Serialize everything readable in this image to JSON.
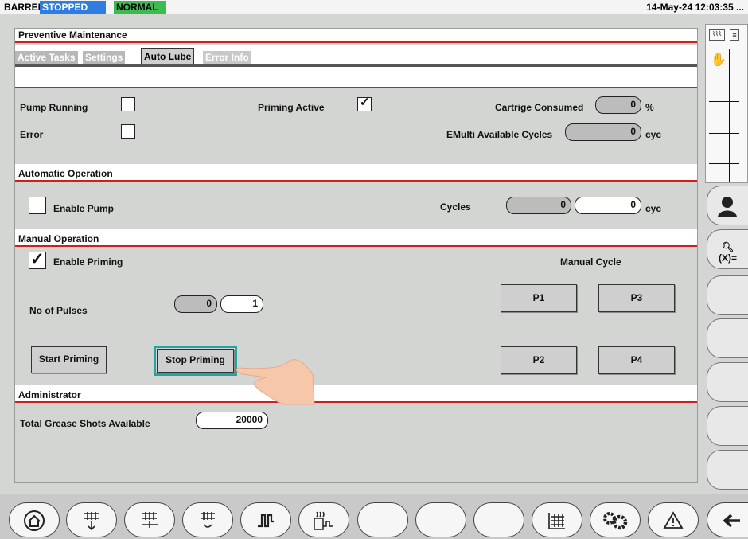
{
  "status": {
    "barrel": "BARREL",
    "state": "STOPPED",
    "mode": "NORMAL",
    "datetime": "14-May-24 12:03:35 ..."
  },
  "panel": {
    "title": "Preventive Maintenance",
    "tabs": [
      {
        "label": "Active Tasks"
      },
      {
        "label": "Settings"
      },
      {
        "label": "Auto Lube"
      },
      {
        "label": "Error Info"
      }
    ],
    "status_section": {
      "pump_running_label": "Pump Running",
      "pump_running": false,
      "error_label": "Error",
      "error": false,
      "priming_active_label": "Priming Active",
      "priming_active": true,
      "cartridge_label": "Cartrige Consumed",
      "cartridge_value": "0",
      "cartridge_unit": "%",
      "emulti_label": "EMulti Available Cycles",
      "emulti_value": "0",
      "emulti_unit": "cyc"
    },
    "auto": {
      "title": "Automatic Operation",
      "enable_pump_label": "Enable Pump",
      "enable_pump": false,
      "cycles_label": "Cycles",
      "cycles_actual": "0",
      "cycles_set": "0",
      "cycles_unit": "cyc"
    },
    "manual": {
      "title": "Manual Operation",
      "enable_priming_label": "Enable Priming",
      "enable_priming": true,
      "manual_cycle_label": "Manual Cycle",
      "pulses_label": "No of Pulses",
      "pulses_actual": "0",
      "pulses_set": "1",
      "start_label": "Start Priming",
      "stop_label": "Stop Priming",
      "p1": "P1",
      "p2": "P2",
      "p3": "P3",
      "p4": "P4"
    },
    "admin": {
      "title": "Administrator",
      "shots_label": "Total Grease Shots Available",
      "shots_value": "20000"
    }
  },
  "colors": {
    "stopped": "#2f7de0",
    "normal": "#3cbc50",
    "section_rule": "#cc2020",
    "selected_outline": "#23a5a5"
  },
  "bottom_icons": [
    "home-icon",
    "mold-open-icon",
    "mold-close-icon",
    "ejector-icon",
    "injection-icon",
    "heater-icon",
    "empty",
    "empty",
    "empty",
    "grid-icon",
    "settings-gears-icon",
    "alarm-warning-icon",
    "back-arrow-icon"
  ]
}
